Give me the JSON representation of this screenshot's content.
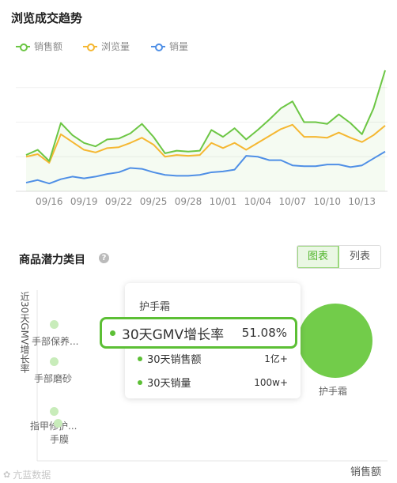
{
  "trend": {
    "title": "浏览成交趋势",
    "legend": [
      {
        "label": "销售额",
        "color": "#6cc644"
      },
      {
        "label": "浏览量",
        "color": "#f5b731"
      },
      {
        "label": "销量",
        "color": "#4f8fe6"
      }
    ]
  },
  "chart_data": {
    "type": "line",
    "x": [
      "09/14",
      "09/15",
      "09/16",
      "09/17",
      "09/18",
      "09/19",
      "09/20",
      "09/21",
      "09/22",
      "09/23",
      "09/24",
      "09/25",
      "09/26",
      "09/27",
      "09/28",
      "09/29",
      "09/30",
      "10/01",
      "10/02",
      "10/03",
      "10/04",
      "10/05",
      "10/06",
      "10/07",
      "10/08",
      "10/09",
      "10/10",
      "10/11",
      "10/12",
      "10/13",
      "10/14",
      "10/15"
    ],
    "x_tick_labels": [
      "09/16",
      "09/19",
      "09/22",
      "09/25",
      "09/28",
      "10/01",
      "10/04",
      "10/07",
      "10/10",
      "10/13"
    ],
    "series": [
      {
        "name": "销售额",
        "color": "#6cc644",
        "values": [
          42,
          48,
          35,
          79,
          65,
          56,
          52,
          60,
          61,
          67,
          78,
          63,
          44,
          47,
          46,
          47,
          71,
          63,
          73,
          60,
          71,
          83,
          96,
          104,
          80,
          80,
          78,
          89,
          79,
          66,
          96,
          140
        ]
      },
      {
        "name": "浏览量",
        "color": "#f5b731",
        "values": [
          40,
          43,
          33,
          66,
          57,
          48,
          45,
          50,
          51,
          56,
          62,
          54,
          40,
          42,
          41,
          42,
          56,
          50,
          56,
          48,
          56,
          64,
          72,
          77,
          63,
          63,
          62,
          68,
          62,
          57,
          65,
          76
        ]
      },
      {
        "name": "销量",
        "color": "#4f8fe6",
        "values": [
          10,
          13,
          9,
          14,
          17,
          15,
          17,
          20,
          22,
          27,
          26,
          22,
          19,
          18,
          18,
          19,
          22,
          23,
          25,
          41,
          40,
          36,
          36,
          30,
          29,
          29,
          31,
          31,
          28,
          30,
          38,
          46
        ]
      }
    ],
    "grid": true,
    "area_fill_series": "销售额"
  },
  "potential": {
    "title": "商品潜力类目",
    "help_icon": "question-icon",
    "tabs": [
      "图表",
      "列表"
    ],
    "ylabel": "近30天GMV增长率",
    "xlabel": "销售额",
    "bubbles": [
      {
        "label": "手部保养..."
      },
      {
        "label": "手部磨砂"
      },
      {
        "label": "指甲修护..."
      },
      {
        "label": "手膜"
      },
      {
        "label": "护手霜"
      }
    ]
  },
  "tooltip": {
    "title": "护手霜",
    "rows": [
      {
        "label": "30天GMV增长率",
        "value": "51.08%"
      },
      {
        "label": "30天销售额",
        "value": "1亿+"
      },
      {
        "label": "30天销量",
        "value": "100w+"
      }
    ]
  },
  "watermark": "亢蓝数据"
}
